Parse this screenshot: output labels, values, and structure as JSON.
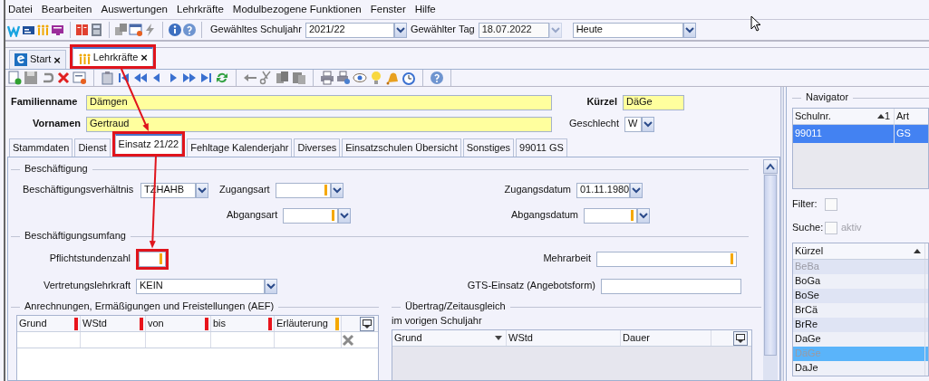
{
  "menu": [
    {
      "label": "Datei"
    },
    {
      "label": "Bearbeiten"
    },
    {
      "label": "Auswertungen"
    },
    {
      "label": "Lehrkräfte"
    },
    {
      "label": "Modulbezogene Funktionen"
    },
    {
      "label": "Fenster"
    },
    {
      "label": "Hilfe"
    }
  ],
  "toolbar": {
    "schuljahr_label": "Gewähltes Schuljahr",
    "schuljahr": "2021/22",
    "tag_label": "Gewählter Tag",
    "tag": "18.07.2022",
    "tag_disabled": true,
    "preset": "Heute"
  },
  "doc_tabs": [
    {
      "label": "Start",
      "close": "×",
      "kind": "start",
      "selected": false,
      "highlighted": false
    },
    {
      "label": "Lehrkräfte",
      "close": "×",
      "kind": "teachers",
      "selected": true,
      "highlighted": true
    }
  ],
  "header": {
    "familienname_label": "Familienname",
    "familienname": "Dämgen",
    "kuerzel_label": "Kürzel",
    "kuerzel": "DäGe",
    "vornamen_label": "Vornamen",
    "vornamen": "Gertraud",
    "geschlecht_label": "Geschlecht",
    "geschlecht": "W"
  },
  "tabs": [
    {
      "label": "Stammdaten",
      "selected": false,
      "highlighted": false
    },
    {
      "label": "Dienst",
      "selected": false,
      "highlighted": false
    },
    {
      "label": "Einsatz 21/22",
      "selected": true,
      "highlighted": true
    },
    {
      "label": "Fehltage Kalenderjahr",
      "selected": false,
      "highlighted": false
    },
    {
      "label": "Diverses",
      "selected": false,
      "highlighted": false
    },
    {
      "label": "Einsatzschulen Übersicht",
      "selected": false,
      "highlighted": false
    },
    {
      "label": "Sonstiges",
      "selected": false,
      "highlighted": false
    },
    {
      "label": "99011 GS",
      "selected": false,
      "highlighted": false
    }
  ],
  "beschaeftigung": {
    "legend": "Beschäftigung",
    "verhaeltnis": {
      "label": "Beschäftigungsverhältnis",
      "value": "TZHAHB",
      "marked": false
    },
    "zugangsart": {
      "label": "Zugangsart",
      "marked": true
    },
    "zugangsdatum": {
      "label": "Zugangsdatum",
      "value": "01.11.1980",
      "marked": false
    },
    "abgangsart": {
      "label": "Abgangsart",
      "marked": true
    },
    "abgangsdatum": {
      "label": "Abgangsdatum",
      "marked": true
    }
  },
  "umfang": {
    "legend": "Beschäftigungsumfang",
    "pflichtstunden": {
      "label": "Pflichtstundenzahl",
      "marked": true,
      "highlighted": true
    },
    "mehrarbeit": {
      "label": "Mehrarbeit",
      "marked": true
    },
    "vertretung": {
      "label": "Vertretungslehrkraft",
      "value": "KEIN",
      "marked": false
    },
    "gts": {
      "label": "GTS-Einsatz (Angebotsform)",
      "marked": false
    }
  },
  "aef": {
    "legend": "Anrechnungen, Ermäßigungen und Freistellungen (AEF)",
    "columns": [
      {
        "label": "Grund",
        "color": "#e8141c"
      },
      {
        "label": "WStd",
        "color": "#e8141c"
      },
      {
        "label": "von",
        "color": "#e8141c"
      },
      {
        "label": "bis",
        "color": "#e8141c"
      },
      {
        "label": "Erläuterung",
        "color": "#f5a800"
      }
    ]
  },
  "uebertrag": {
    "legend": "Übertrag/Zeitausgleich",
    "caption": "im vorigen Schuljahr",
    "columns": [
      {
        "label": "Grund",
        "sorted": true
      },
      {
        "label": "WStd",
        "sorted": false
      },
      {
        "label": "Dauer",
        "sorted": false
      }
    ]
  },
  "navigator": {
    "legend": "Navigator",
    "schulen": {
      "columns": [
        {
          "label": "Schulnr.",
          "sort_rank": "1"
        },
        {
          "label": "Art"
        }
      ],
      "rows": [
        {
          "cells": [
            "99011",
            "GS"
          ],
          "selected": true
        }
      ]
    },
    "filter_label": "Filter:",
    "filter_checked": false,
    "suche_label": "Suche:",
    "suche_option": "aktiv",
    "suche_checked": false,
    "suche_disabled": true,
    "lehrer": {
      "columns": [
        {
          "label": "Kürzel"
        }
      ],
      "rows": [
        {
          "cells": [
            "BeBa"
          ],
          "selected": false,
          "disabled": true
        },
        {
          "cells": [
            "BoGa"
          ],
          "selected": false,
          "disabled": false
        },
        {
          "cells": [
            "BoSe"
          ],
          "selected": false,
          "disabled": false
        },
        {
          "cells": [
            "BrCä"
          ],
          "selected": false,
          "disabled": false
        },
        {
          "cells": [
            "BrRe"
          ],
          "selected": false,
          "disabled": false
        },
        {
          "cells": [
            "DaGe"
          ],
          "selected": false,
          "disabled": false
        },
        {
          "cells": [
            "DäGe"
          ],
          "selected": true,
          "disabled": true
        },
        {
          "cells": [
            "DaJe"
          ],
          "selected": false,
          "disabled": false
        }
      ]
    }
  }
}
